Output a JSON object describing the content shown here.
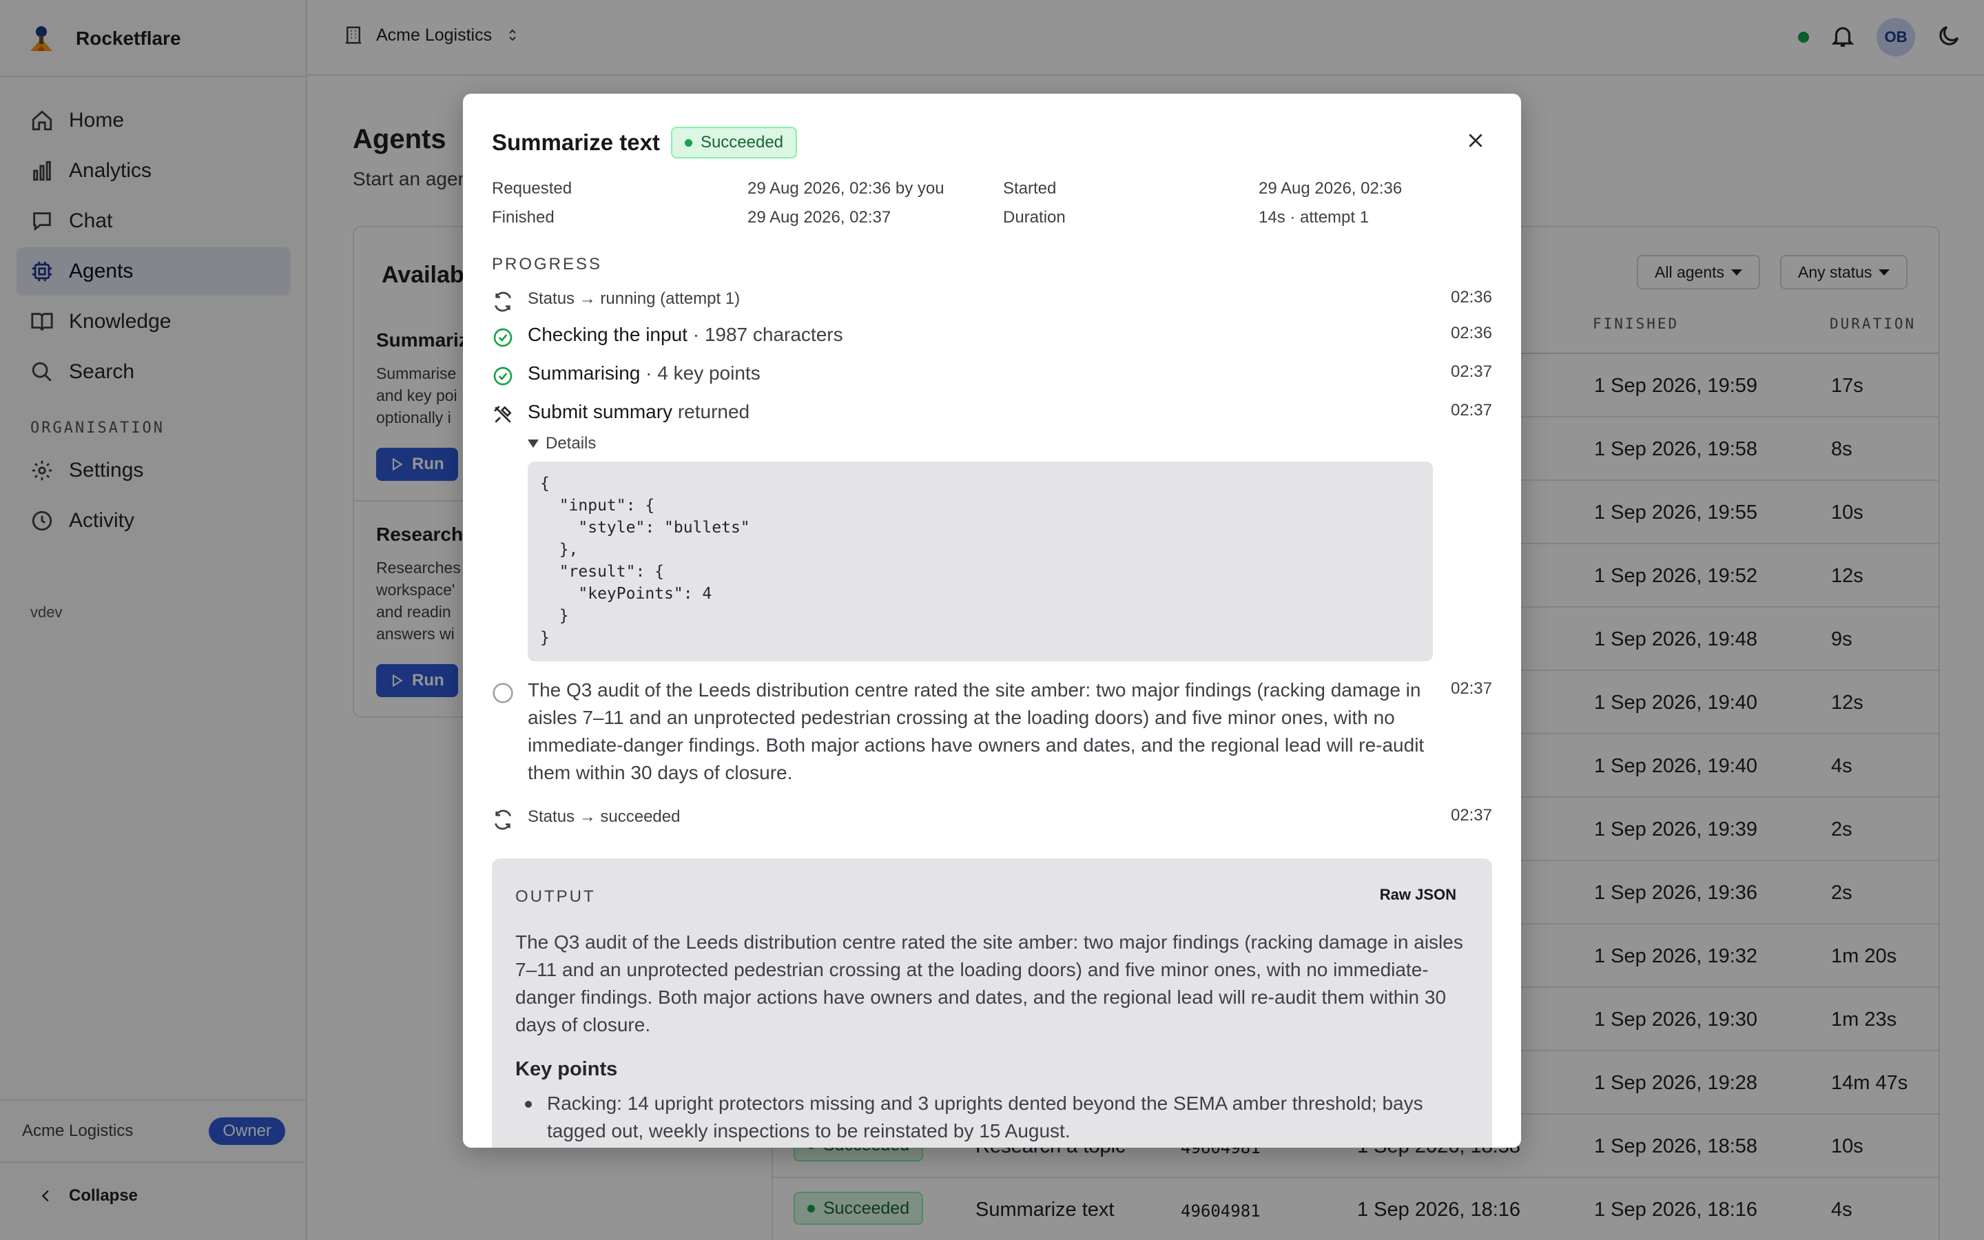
{
  "app": {
    "name": "Rocketflare",
    "org": "Acme Logistics",
    "user_initials": "OB",
    "version": "vdev"
  },
  "sidebar": {
    "items": [
      {
        "label": "Home",
        "icon": "home-icon"
      },
      {
        "label": "Analytics",
        "icon": "analytics-icon"
      },
      {
        "label": "Chat",
        "icon": "chat-icon"
      },
      {
        "label": "Agents",
        "icon": "agents-icon",
        "active": true
      },
      {
        "label": "Knowledge",
        "icon": "book-icon"
      },
      {
        "label": "Search",
        "icon": "search-icon"
      }
    ],
    "section": "ORGANISATION",
    "org_items": [
      {
        "label": "Settings",
        "icon": "gear-icon"
      },
      {
        "label": "Activity",
        "icon": "clock-icon"
      }
    ],
    "footer_org": "Acme Logistics",
    "footer_role": "Owner",
    "collapse_label": "Collapse"
  },
  "page": {
    "title": "Agents",
    "subtitle": "Start an agen"
  },
  "available": {
    "title": "Availabl",
    "agents": [
      {
        "name": "Summariz",
        "desc_lines": [
          "Summarise",
          "and key poi",
          "optionally i"
        ],
        "run_label": "Run"
      },
      {
        "name": "Research",
        "desc_lines": [
          "Researches",
          "workspace'",
          "and readin",
          "answers wi"
        ],
        "run_label": "Run"
      }
    ]
  },
  "runs": {
    "filters": [
      "All agents",
      "Any status"
    ],
    "columns": {
      "finished": "FINISHED",
      "duration": "DURATION"
    },
    "rows": [
      {
        "finished": "1 Sep 2026, 19:59",
        "duration": "17s"
      },
      {
        "finished": "1 Sep 2026, 19:58",
        "duration": "8s"
      },
      {
        "finished": "1 Sep 2026, 19:55",
        "duration": "10s"
      },
      {
        "finished": "1 Sep 2026, 19:52",
        "duration": "12s"
      },
      {
        "finished": "1 Sep 2026, 19:48",
        "duration": "9s"
      },
      {
        "finished": "1 Sep 2026, 19:40",
        "duration": "12s"
      },
      {
        "finished": "1 Sep 2026, 19:40",
        "duration": "4s"
      },
      {
        "finished": "1 Sep 2026, 19:39",
        "duration": "2s"
      },
      {
        "finished": "1 Sep 2026, 19:36",
        "duration": "2s"
      },
      {
        "finished": "1 Sep 2026, 19:32",
        "duration": "1m 20s"
      },
      {
        "finished": "1 Sep 2026, 19:30",
        "duration": "1m 23s"
      },
      {
        "finished": "1 Sep 2026, 19:28",
        "duration": "14m 47s"
      },
      {
        "status": "Succeeded",
        "agent": "Research a topic",
        "id": "49604981",
        "started": "1 Sep 2026, 18:58",
        "finished": "1 Sep 2026, 18:58",
        "duration": "10s"
      },
      {
        "status": "Succeeded",
        "agent": "Summarize text",
        "id": "49604981",
        "started": "1 Sep 2026, 18:16",
        "finished": "1 Sep 2026, 18:16",
        "duration": "4s"
      }
    ]
  },
  "modal": {
    "title": "Summarize text",
    "status": "Succeeded",
    "meta": {
      "requested_label": "Requested",
      "requested_value": "29 Aug 2026, 02:36 by you",
      "started_label": "Started",
      "started_value": "29 Aug 2026, 02:36",
      "finished_label": "Finished",
      "finished_value": "29 Aug 2026, 02:37",
      "duration_label": "Duration",
      "duration_value": "14s · attempt 1"
    },
    "progress_label": "PROGRESS",
    "events": [
      {
        "text": "Status → running (attempt 1)",
        "time": "02:36"
      },
      {
        "strong": "Checking the input",
        "rest": " · 1987 characters",
        "time": "02:36"
      },
      {
        "strong": "Summarising",
        "rest": " · 4 key points",
        "time": "02:37"
      },
      {
        "strong": "Submit summary",
        "rest": " returned",
        "time": "02:37"
      },
      {
        "text": "The Q3 audit of the Leeds distribution centre rated the site amber: two major findings (racking damage in aisles 7–11 and an unprotected pedestrian crossing at the loading doors) and five minor ones, with no immediate-danger findings. Both major actions have owners and dates, and the regional lead will re-audit them within 30 days of closure.",
        "time": "02:37"
      },
      {
        "text": "Status → succeeded",
        "time": "02:37"
      }
    ],
    "details_label": "Details",
    "details_json": "{\n  \"input\": {\n    \"style\": \"bullets\"\n  },\n  \"result\": {\n    \"keyPoints\": 4\n  }\n}",
    "output": {
      "label": "OUTPUT",
      "raw_json_label": "Raw JSON",
      "text": "The Q3 audit of the Leeds distribution centre rated the site amber: two major findings (racking damage in aisles 7–11 and an unprotected pedestrian crossing at the loading doors) and five minor ones, with no immediate-danger findings. Both major actions have owners and dates, and the regional lead will re-audit them within 30 days of closure.",
      "key_points_title": "Key points",
      "key_points": [
        "Racking: 14 upright protectors missing and 3 uprights dented beyond the SEMA amber threshold; bays tagged out, weekly inspections to be reinstated by 15 August."
      ]
    }
  },
  "colors": {
    "accent": "#2f5bd6",
    "success": "#16a34a",
    "success_bg": "#dcf6e4"
  }
}
